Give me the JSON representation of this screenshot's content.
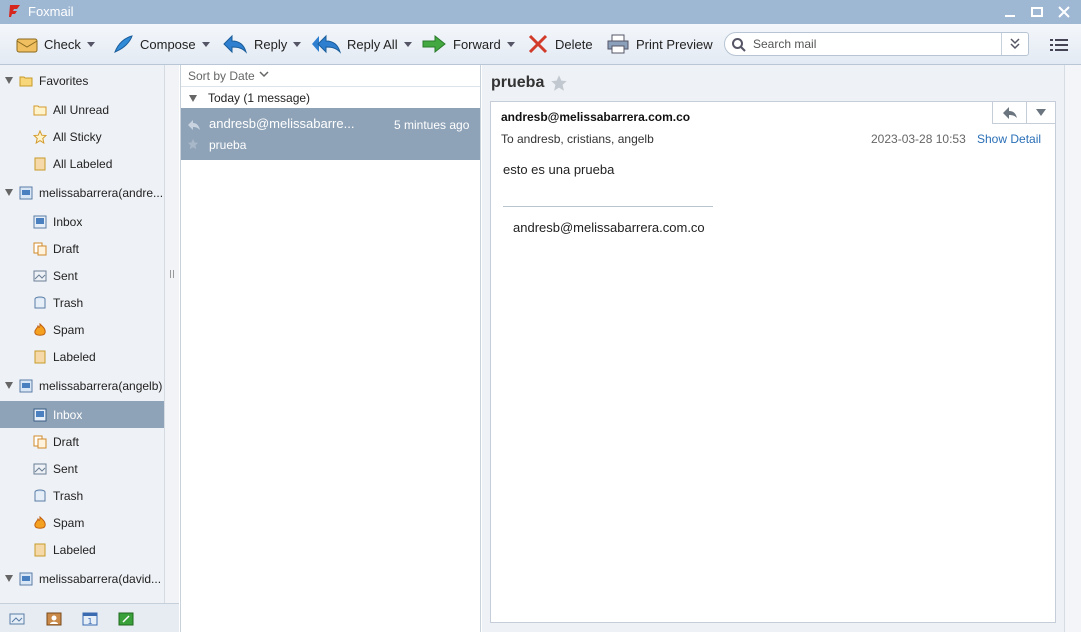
{
  "window": {
    "title": "Foxmail"
  },
  "toolbar": {
    "check": "Check",
    "compose": "Compose",
    "reply": "Reply",
    "reply_all": "Reply All",
    "forward": "Forward",
    "delete": "Delete",
    "print_preview": "Print Preview",
    "search_placeholder": "Search mail"
  },
  "sidebar": {
    "favorites": {
      "label": "Favorites",
      "items": [
        {
          "label": "All Unread",
          "icon": "folder-icon"
        },
        {
          "label": "All Sticky",
          "icon": "star-icon"
        },
        {
          "label": "All Labeled",
          "icon": "label-icon"
        }
      ]
    },
    "accounts": [
      {
        "label": "melissabarrera(andre...",
        "folders": [
          {
            "label": "Inbox",
            "icon": "inbox-icon"
          },
          {
            "label": "Draft",
            "icon": "draft-icon"
          },
          {
            "label": "Sent",
            "icon": "sent-icon"
          },
          {
            "label": "Trash",
            "icon": "trash-icon"
          },
          {
            "label": "Spam",
            "icon": "spam-icon"
          },
          {
            "label": "Labeled",
            "icon": "label-icon"
          }
        ]
      },
      {
        "label": "melissabarrera(angelb)",
        "folders": [
          {
            "label": "Inbox",
            "icon": "inbox-icon",
            "selected": true
          },
          {
            "label": "Draft",
            "icon": "draft-icon"
          },
          {
            "label": "Sent",
            "icon": "sent-icon"
          },
          {
            "label": "Trash",
            "icon": "trash-icon"
          },
          {
            "label": "Spam",
            "icon": "spam-icon"
          },
          {
            "label": "Labeled",
            "icon": "label-icon"
          }
        ]
      },
      {
        "label": "melissabarrera(david..."
      }
    ]
  },
  "message_list": {
    "sort_label": "Sort by Date",
    "group_label": "Today (1 message)",
    "items": [
      {
        "from": "andresb@melissabarre...",
        "time": "5 mintues ago",
        "subject": "prueba"
      }
    ]
  },
  "reader": {
    "subject": "prueba",
    "from": "andresb@melissabarrera.com.co",
    "to": "To andresb, cristians, angelb",
    "date": "2023-03-28  10:53",
    "show_detail": "Show Detail",
    "body": "esto es una prueba",
    "signature": "andresb@melissabarrera.com.co"
  },
  "colors": {
    "titlebar": "#9eb7d3",
    "selection": "#8fa3b8",
    "link": "#2a6fb7"
  }
}
